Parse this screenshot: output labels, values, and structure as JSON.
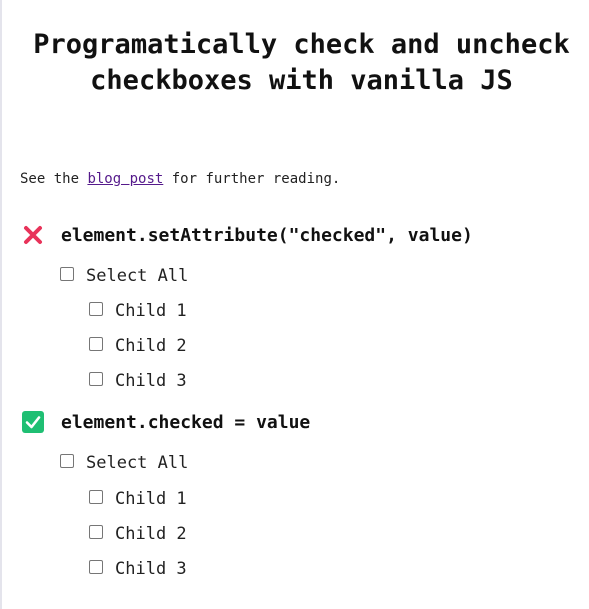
{
  "page": {
    "title": "Programatically check and uncheck checkboxes with vanilla JS",
    "intro_before": "See the ",
    "intro_link": "blog post",
    "intro_after": " for further reading."
  },
  "sections": [
    {
      "status_icon": "cross-icon",
      "status_color": "#e8335a",
      "heading": "element.setAttribute(\"checked\", value)",
      "select_all_label": "Select All",
      "children": [
        {
          "label": "Child 1",
          "checked": false
        },
        {
          "label": "Child 2",
          "checked": false
        },
        {
          "label": "Child 3",
          "checked": false
        }
      ],
      "select_all_checked": false
    },
    {
      "status_icon": "checkmark-icon",
      "status_color": "#1fbf73",
      "heading": "element.checked = value",
      "select_all_label": "Select All",
      "children": [
        {
          "label": "Child 1",
          "checked": false
        },
        {
          "label": "Child 2",
          "checked": false
        },
        {
          "label": "Child 3",
          "checked": false
        }
      ],
      "select_all_checked": false
    }
  ]
}
